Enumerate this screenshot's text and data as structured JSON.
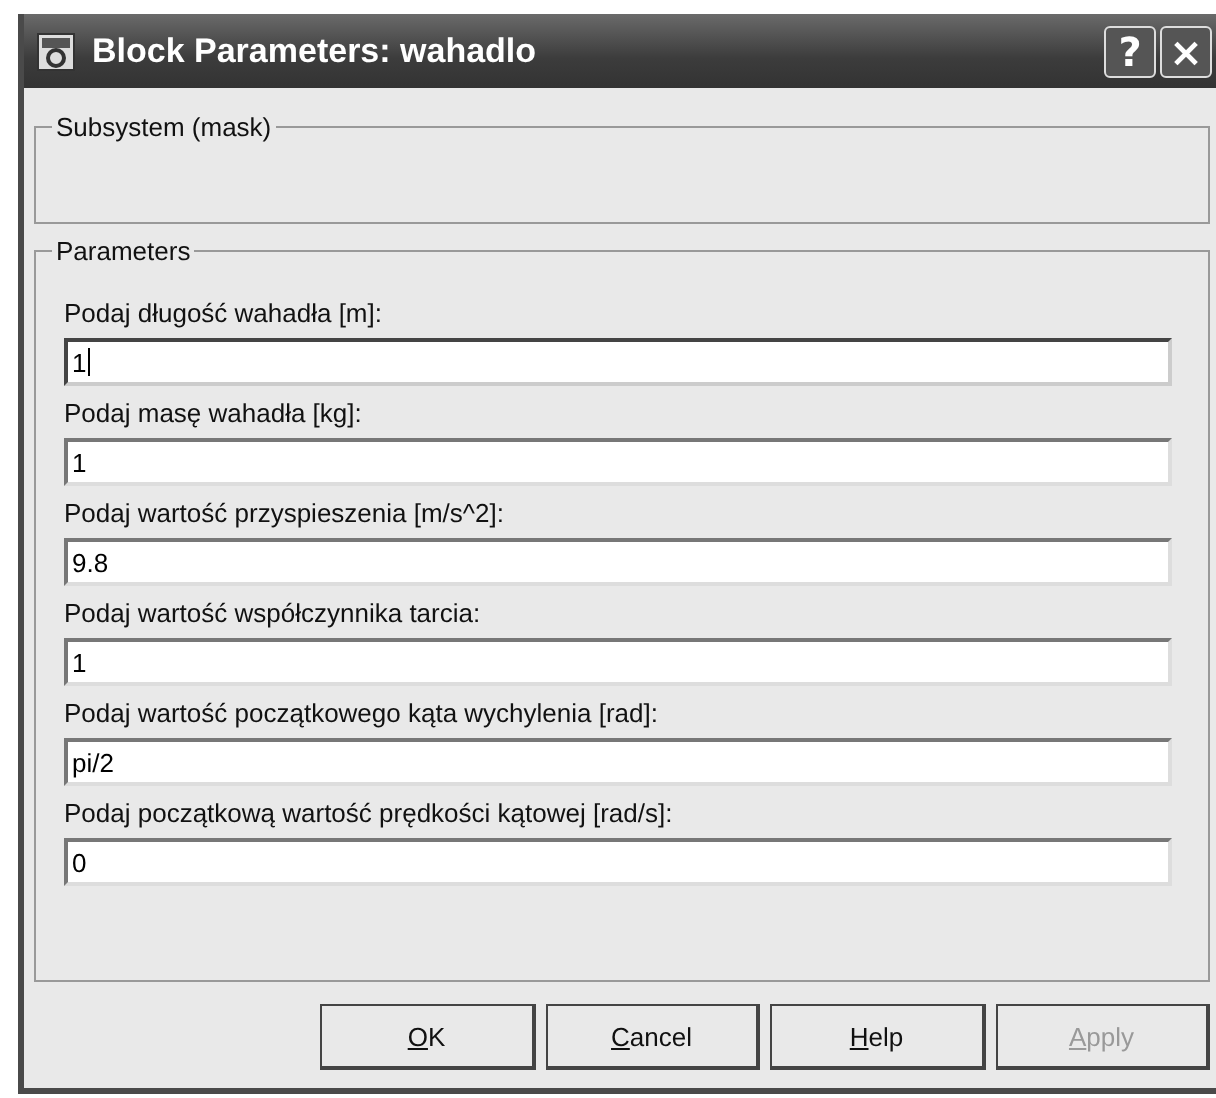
{
  "window": {
    "title": "Block Parameters: wahadlo",
    "title_buttons": [
      "?",
      "×"
    ]
  },
  "subsystem": {
    "title": "Subsystem (mask)"
  },
  "parameters": {
    "title": "Parameters",
    "fields": [
      {
        "label": "Podaj długość wahadła [m]:",
        "value": "1",
        "focused": true
      },
      {
        "label": "Podaj masę wahadła [kg]:",
        "value": "1",
        "focused": false
      },
      {
        "label": "Podaj wartość przyspieszenia [m/s^2]:",
        "value": "9.8",
        "focused": false
      },
      {
        "label": "Podaj wartość współczynnika tarcia:",
        "value": "1",
        "focused": false
      },
      {
        "label": "Podaj wartość początkowego kąta wychylenia [rad]:",
        "value": "pi/2",
        "focused": false
      },
      {
        "label": "Podaj początkową wartość prędkości kątowej [rad/s]:",
        "value": "0",
        "focused": false
      }
    ]
  },
  "buttons": [
    {
      "label": "OK",
      "disabled": false
    },
    {
      "label": "Cancel",
      "disabled": false
    },
    {
      "label": "Help",
      "disabled": false
    },
    {
      "label": "Apply",
      "disabled": true
    }
  ]
}
